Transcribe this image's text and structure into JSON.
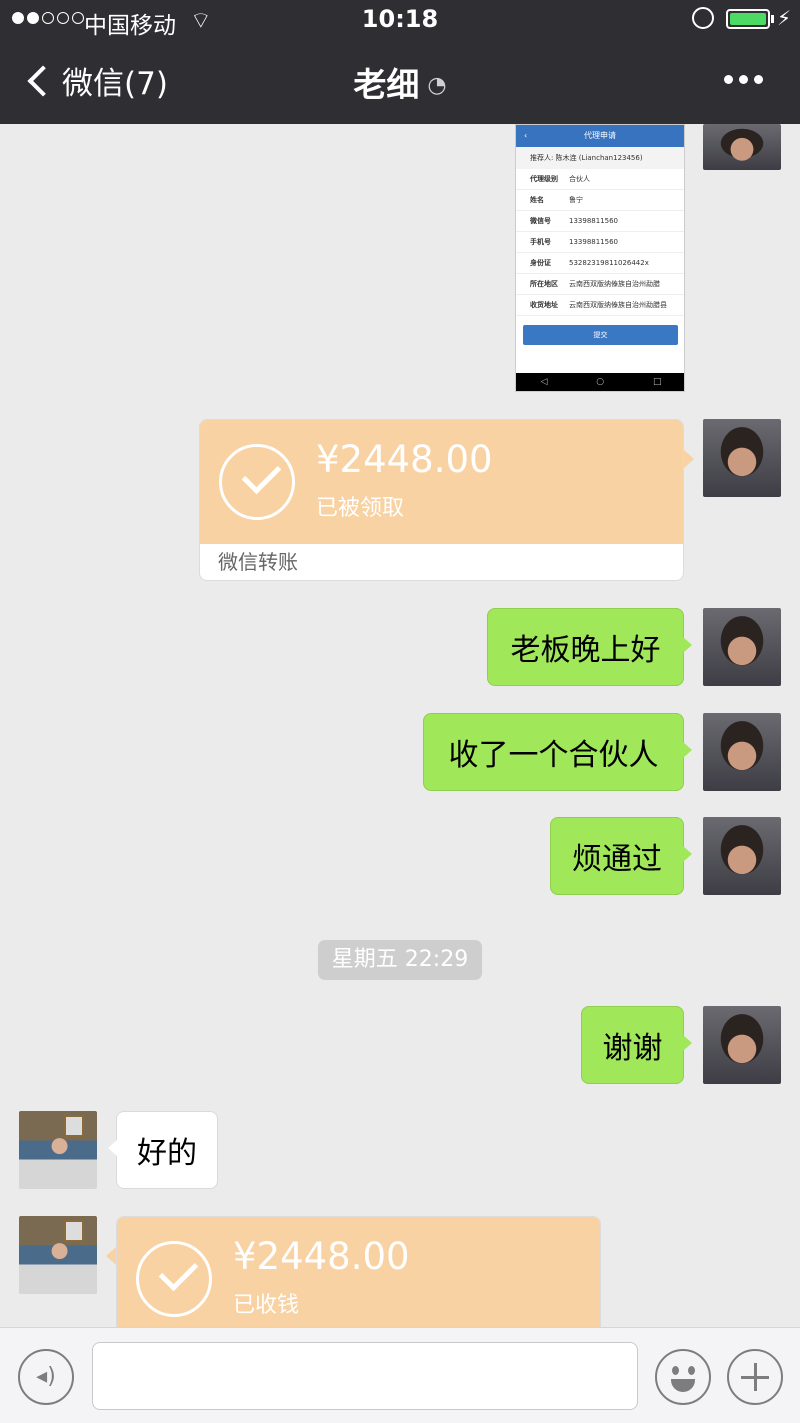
{
  "status_bar": {
    "carrier": "中国移动",
    "time": "10:18"
  },
  "nav": {
    "back_label": "微信(7)",
    "title": "老细"
  },
  "chat": {
    "screenshot_message": {
      "header": "代理申请",
      "referrer": "推荐人: 陈木连 (Lianchan123456)",
      "rows": [
        {
          "label": "代理级别",
          "value": "合伙人"
        },
        {
          "label": "姓名",
          "value": "鲁宁"
        },
        {
          "label": "微信号",
          "value": "13398811560"
        },
        {
          "label": "手机号",
          "value": "13398811560"
        },
        {
          "label": "身份证",
          "value": "53282319811026442x"
        },
        {
          "label": "所在地区",
          "value": "云南西双版纳傣族自治州勐腊"
        },
        {
          "label": "收货地址",
          "value": "云南西双版纳傣族自治州勐腊县"
        }
      ],
      "submit": "提交"
    },
    "transfer_sent": {
      "amount": "¥2448.00",
      "state": "已被领取",
      "footer": "微信转账"
    },
    "messages_out": [
      "老板晚上好",
      "收了一个合伙人",
      "烦通过"
    ],
    "timestamp": "星期五 22:29",
    "message_out_after": "谢谢",
    "message_in": "好的",
    "transfer_received": {
      "amount": "¥2448.00",
      "state": "已收钱"
    }
  },
  "colors": {
    "nav_bg": "#2e2e33",
    "outgoing_bubble": "#a0e75a",
    "transfer_card": "#f8d2a2",
    "chat_bg": "#ebebeb"
  },
  "icons": [
    "back-chevron-icon",
    "ear-icon",
    "more-icon",
    "voice-icon",
    "emoji-icon",
    "plus-icon"
  ]
}
